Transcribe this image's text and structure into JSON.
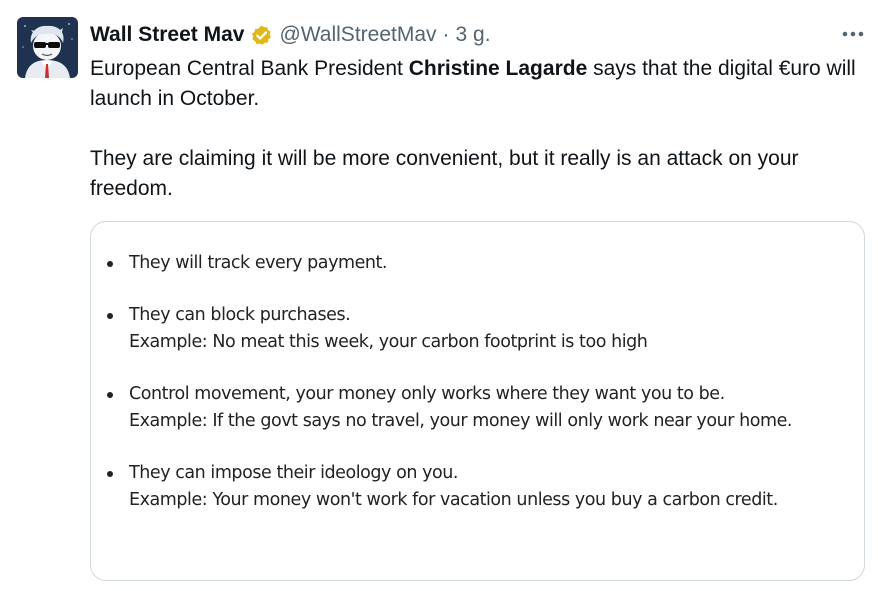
{
  "author": {
    "display_name": "Wall Street Mav",
    "handle": "@WallStreetMav",
    "separator": "·",
    "time": "3 g."
  },
  "tweet": {
    "line1_before": "European Central Bank President ",
    "line1_bold": "Christine Lagarde",
    "line1_after": " says that the digital €uro will launch in October.",
    "paragraph2": "They are claiming it will be more convenient, but it really is an attack on your freedom."
  },
  "media": {
    "items": [
      {
        "line1": "They will track every payment.",
        "line2": ""
      },
      {
        "line1": "They can block purchases.",
        "line2": "Example: No meat this week, your carbon footprint is too high"
      },
      {
        "line1": "Control movement, your money only works where they want you to be.",
        "line2": "Example: If the govt says no travel, your money will only work near your home."
      },
      {
        "line1": "They can impose their ideology on you.",
        "line2": "Example: Your money won't work for vacation unless you buy a carbon credit."
      }
    ]
  },
  "icons": {
    "avatar": "avatar-cartoon-sunglasses",
    "verified": "verified-badge-icon",
    "more": "more-horizontal-icon"
  },
  "colors": {
    "text": "#0f1419",
    "secondary_text": "#536471",
    "verified_gold": "#e2b719",
    "card_border": "#cfd9de"
  }
}
